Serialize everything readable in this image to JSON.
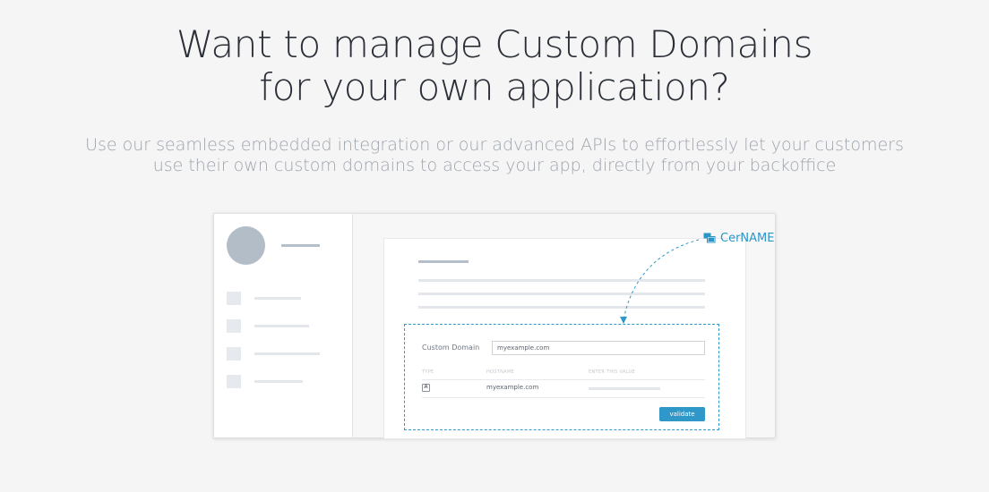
{
  "hero": {
    "title_line1": "Want to manage Custom Domains",
    "title_line2": "for your own application?",
    "subtitle_line1": "Use our seamless embedded integration or our advanced APIs to effortlessly let your customers",
    "subtitle_line2": "use their own custom domains to access your app, directly from your backoffice"
  },
  "annotation": {
    "label": "CerNAME",
    "icon": "chat-bubbles-icon",
    "color": "#2b95c7"
  },
  "form": {
    "custom_domain_label": "Custom Domain",
    "custom_domain_value": "myexample.com",
    "columns": [
      "TYPE",
      "HOSTNAME",
      "ENTER THIS VALUE"
    ],
    "row": {
      "type": "A",
      "hostname": "myexample.com"
    },
    "validate_label": "validate"
  },
  "colors": {
    "accent": "#2f98c8",
    "background": "#f5f5f5",
    "title": "#2b2f38",
    "subtitle": "#9ea4ad"
  }
}
